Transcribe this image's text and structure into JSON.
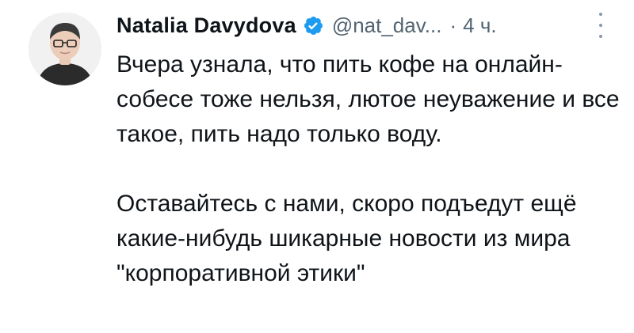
{
  "tweet": {
    "author": {
      "name": "Natalia Davydova",
      "handle": "@nat_dav...",
      "verified": true,
      "avatar_icon": "user-avatar-photo"
    },
    "separator": "·",
    "time": "4 ч.",
    "menu_icon": "more-vertical-icon",
    "paragraphs": [
      "Вчера узнала, что пить кофе на онлайн-собесе тоже нельзя, лютое неуважение и все такое, пить надо только воду.",
      "Оставайтесь с нами, скоро подъедут ещё какие-нибудь шикарные новости из мира \"корпоративной этики\""
    ]
  },
  "colors": {
    "text": "#0f1419",
    "secondary": "#536471",
    "verified_badge": "#1d9bf0",
    "background": "#ffffff"
  }
}
